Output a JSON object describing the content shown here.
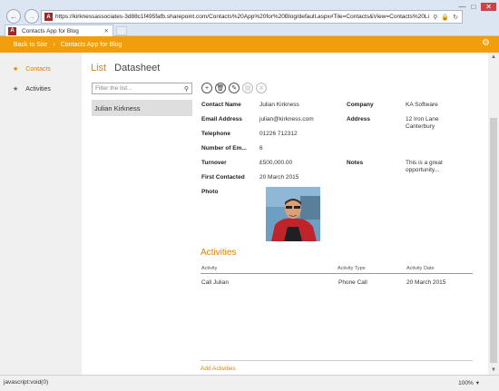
{
  "browser": {
    "url": "https://kirknessassociates-3d88c1f495fafb.sharepoint.com/Contacts%20App%20for%20Blog/default.aspx#Tile=Contacts&View=Contacts%20List",
    "tab_title": "Contacts App for Blog",
    "favicon_letter": "A",
    "status_text": "javascript:void(0)",
    "zoom": "100%"
  },
  "suite_bar": {
    "back_label": "Back to Site",
    "app_title": "Contacts App for Blog"
  },
  "left_nav": {
    "items": [
      {
        "label": "Contacts",
        "active": true
      },
      {
        "label": "Activities",
        "active": false
      }
    ]
  },
  "views": {
    "list": "List",
    "datasheet": "Datasheet"
  },
  "filter": {
    "placeholder": "Filter the list..."
  },
  "list_items": [
    "Julian Kirkness"
  ],
  "record": {
    "contact_name_label": "Contact Name",
    "contact_name": "Julian Kirkness",
    "company_label": "Company",
    "company": "KA Software",
    "email_label": "Email Address",
    "email": "julian@kirkness.com",
    "address_label": "Address",
    "address": "12 Iron Lane Canterbury",
    "telephone_label": "Telephone",
    "telephone": "01226 712312",
    "employees_label": "Number of Em...",
    "employees": "6",
    "turnover_label": "Turnover",
    "turnover": "£500,000.00",
    "notes_label": "Notes",
    "notes": "This is a great opportunity...",
    "first_contacted_label": "First Contacted",
    "first_contacted": "20 March 2015",
    "photo_label": "Photo"
  },
  "activities": {
    "title": "Activities",
    "columns": [
      "Activity",
      "Activity Type",
      "Activity Date"
    ],
    "rows": [
      {
        "activity": "Call Julian",
        "type": "Phone Call",
        "date": "20 March 2015"
      }
    ],
    "add_label": "Add Activities"
  }
}
